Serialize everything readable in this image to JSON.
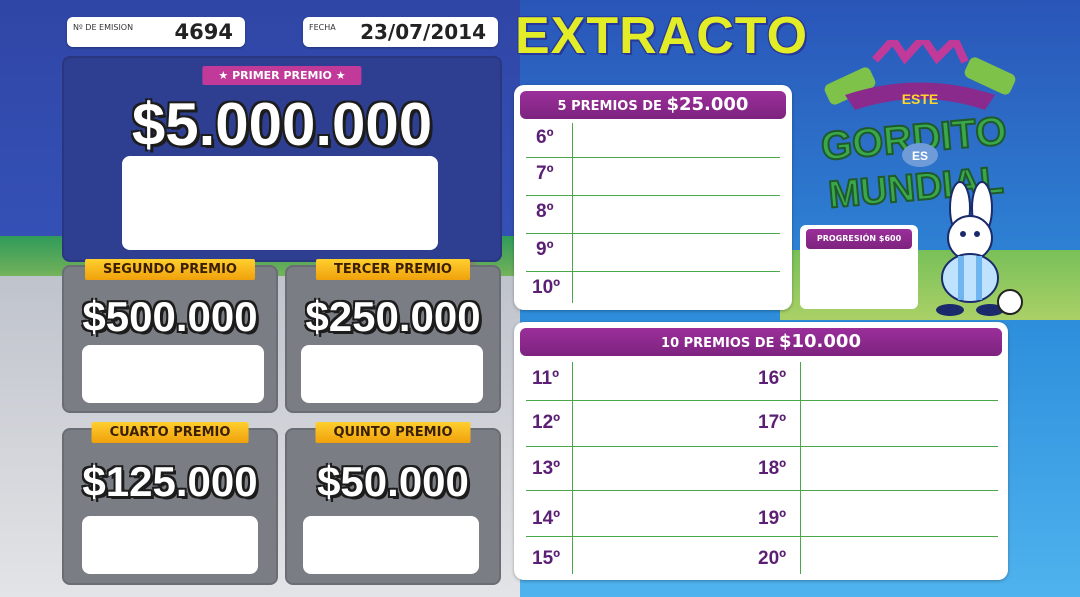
{
  "header": {
    "emision_label": "Nº DE EMISION",
    "emision_value": "4694",
    "fecha_label": "FECHA",
    "fecha_value": "23/07/2014",
    "title": "EXTRACTO"
  },
  "premios": {
    "primer": {
      "label": "★ PRIMER PREMIO ★",
      "amount": "$5.000.000"
    },
    "segundo": {
      "label": "SEGUNDO PREMIO",
      "amount": "$500.000"
    },
    "tercero": {
      "label": "TERCER PREMIO",
      "amount": "$250.000"
    },
    "cuarto": {
      "label": "CUARTO PREMIO",
      "amount": "$125.000"
    },
    "quinto": {
      "label": "QUINTO PREMIO",
      "amount": "$50.000"
    }
  },
  "card5": {
    "prefix": "5 PREMIOS DE",
    "amount": "$25.000",
    "positions": [
      "6º",
      "7º",
      "8º",
      "9º",
      "10º"
    ]
  },
  "card10": {
    "prefix": "10 PREMIOS DE",
    "amount": "$10.000",
    "left_positions": [
      "11º",
      "12º",
      "13º",
      "14º",
      "15º"
    ],
    "right_positions": [
      "16º",
      "17º",
      "18º",
      "19º",
      "20º"
    ]
  },
  "progresion": {
    "label": "PROGRESIÓN",
    "amount": "$600"
  },
  "logo": {
    "top": "ESTE",
    "main1": "GORDITO",
    "mid": "ES",
    "main2": "MUNDIAL"
  },
  "colors": {
    "accent_purple": "#8a2a8c",
    "title_yellow": "#e2ed28",
    "gold": "#f5b21a",
    "navy": "#2e3f92"
  }
}
